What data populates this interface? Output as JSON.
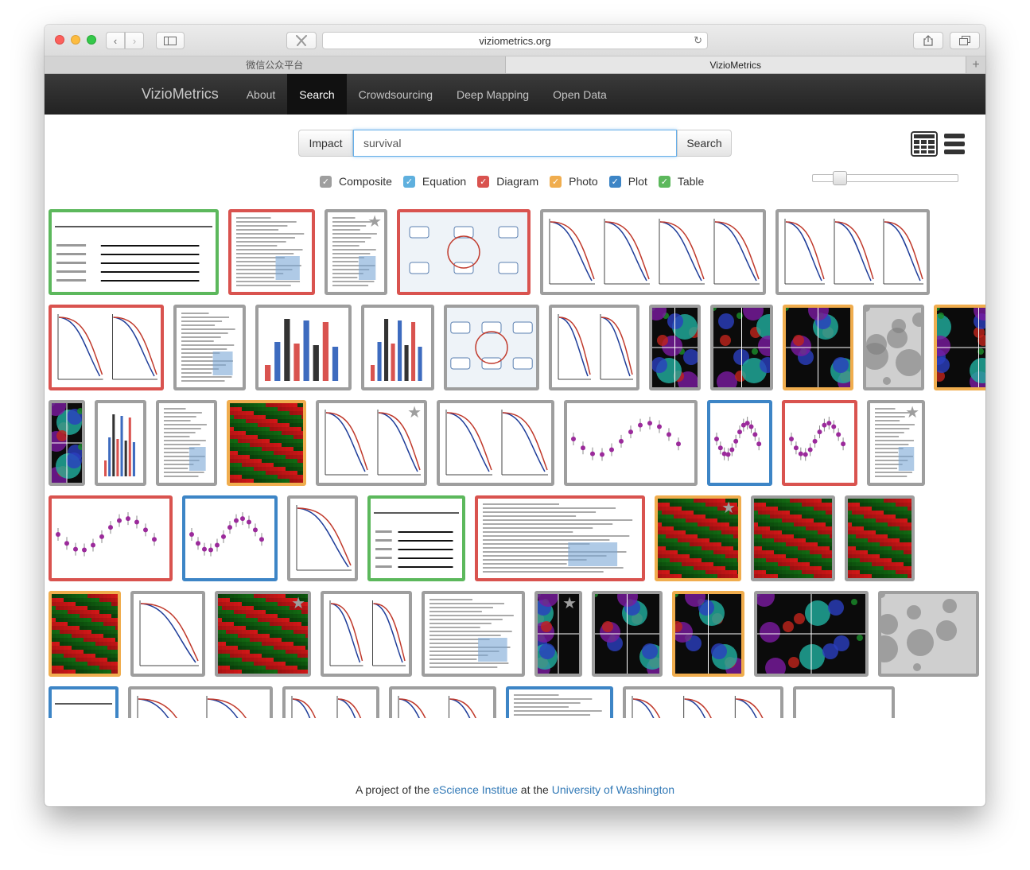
{
  "browser": {
    "url": "viziometrics.org",
    "tabs": [
      "微信公众平台",
      "VizioMetrics"
    ],
    "new_tab": "+"
  },
  "nav": {
    "brand": "VizioMetrics",
    "items": [
      "About",
      "Search",
      "Crowdsourcing",
      "Deep Mapping",
      "Open Data"
    ],
    "active": "Search"
  },
  "search": {
    "sort_label": "Impact",
    "query": "survival",
    "button_label": "Search"
  },
  "filters": [
    {
      "label": "Composite",
      "color": "#9e9e9e",
      "checked": true
    },
    {
      "label": "Equation",
      "color": "#5fb0de",
      "checked": true
    },
    {
      "label": "Diagram",
      "color": "#d9534f",
      "checked": true
    },
    {
      "label": "Photo",
      "color": "#f0ad4e",
      "checked": true
    },
    {
      "label": "Plot",
      "color": "#3d85c6",
      "checked": true
    },
    {
      "label": "Table",
      "color": "#5cb85c",
      "checked": true
    }
  ],
  "thumbnail_size": 0.15,
  "view_modes": [
    "grid-view-icon",
    "list-view-icon"
  ],
  "category_colors": {
    "composite": "#9e9e9e",
    "equation": "#5fb0de",
    "diagram": "#d9534f",
    "photo": "#f0ad4e",
    "plot": "#3d85c6",
    "table": "#5cb85c"
  },
  "results": [
    {
      "cat": "table",
      "kind": "table"
    },
    {
      "cat": "diagram",
      "kind": "doc"
    },
    {
      "cat": "composite",
      "kind": "doc",
      "star": true
    },
    {
      "cat": "diagram",
      "kind": "diagram"
    },
    {
      "cat": "composite",
      "kind": "survival"
    },
    {
      "cat": "composite",
      "kind": "survival"
    },
    {
      "cat": "diagram",
      "kind": "survival"
    },
    {
      "cat": "composite",
      "kind": "doc"
    },
    {
      "cat": "composite",
      "kind": "bars"
    },
    {
      "cat": "composite",
      "kind": "bars"
    },
    {
      "cat": "composite",
      "kind": "diagram"
    },
    {
      "cat": "composite",
      "kind": "survival"
    },
    {
      "cat": "composite",
      "kind": "micro"
    },
    {
      "cat": "composite",
      "kind": "micro"
    },
    {
      "cat": "photo",
      "kind": "micro"
    },
    {
      "cat": "composite",
      "kind": "gray"
    },
    {
      "cat": "photo",
      "kind": "micro"
    },
    {
      "cat": "composite",
      "kind": "micro"
    },
    {
      "cat": "composite",
      "kind": "micro"
    },
    {
      "cat": "composite",
      "kind": "bars"
    },
    {
      "cat": "composite",
      "kind": "doc"
    },
    {
      "cat": "photo",
      "kind": "heat"
    },
    {
      "cat": "composite",
      "kind": "survival",
      "star": true
    },
    {
      "cat": "composite",
      "kind": "survival"
    },
    {
      "cat": "composite",
      "kind": "dots"
    },
    {
      "cat": "plot",
      "kind": "dots"
    },
    {
      "cat": "diagram",
      "kind": "dots"
    },
    {
      "cat": "composite",
      "kind": "doc",
      "star": true
    },
    {
      "cat": "diagram",
      "kind": "dots"
    },
    {
      "cat": "plot",
      "kind": "dots"
    },
    {
      "cat": "composite",
      "kind": "survival"
    },
    {
      "cat": "table",
      "kind": "table"
    },
    {
      "cat": "diagram",
      "kind": "doc"
    },
    {
      "cat": "photo",
      "kind": "heat",
      "star": true
    },
    {
      "cat": "composite",
      "kind": "heat"
    },
    {
      "cat": "composite",
      "kind": "heat"
    },
    {
      "cat": "photo",
      "kind": "heat"
    },
    {
      "cat": "composite",
      "kind": "survival"
    },
    {
      "cat": "composite",
      "kind": "heat",
      "star": true
    },
    {
      "cat": "composite",
      "kind": "survival"
    },
    {
      "cat": "composite",
      "kind": "doc"
    },
    {
      "cat": "composite",
      "kind": "micro",
      "star": true
    },
    {
      "cat": "composite",
      "kind": "micro"
    },
    {
      "cat": "photo",
      "kind": "micro"
    },
    {
      "cat": "composite",
      "kind": "micro"
    },
    {
      "cat": "composite",
      "kind": "gray"
    },
    {
      "cat": "plot",
      "kind": "table"
    },
    {
      "cat": "composite",
      "kind": "survival"
    },
    {
      "cat": "composite",
      "kind": "survival"
    },
    {
      "cat": "composite",
      "kind": "survival"
    },
    {
      "cat": "plot",
      "kind": "doc"
    },
    {
      "cat": "composite",
      "kind": "survival"
    }
  ],
  "footer": {
    "prefix": "A project of the",
    "link1": "eScience Institue",
    "middle": "at the",
    "link2": "University of Washington"
  }
}
